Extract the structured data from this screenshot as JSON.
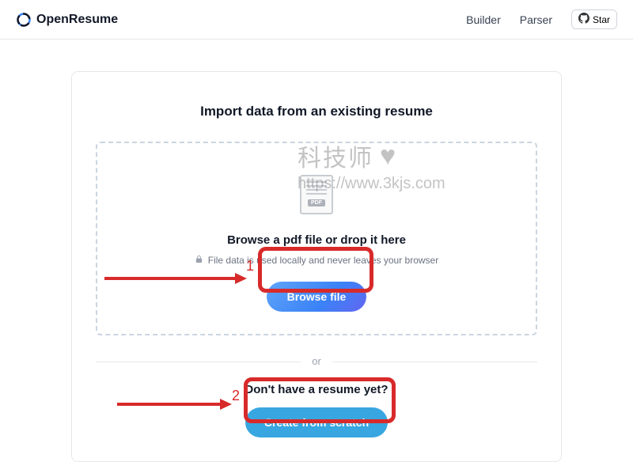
{
  "header": {
    "brand": "OpenResume",
    "nav": {
      "builder": "Builder",
      "parser": "Parser",
      "star": "Star"
    }
  },
  "import": {
    "title": "Import data from an existing resume",
    "file_badge": "PDF",
    "browse_title": "Browse a pdf file or drop it here",
    "privacy": "File data is used locally and never leaves your browser",
    "browse_btn": "Browse file"
  },
  "divider": "or",
  "scratch": {
    "title": "Don't have a resume yet?",
    "create_btn": "Create from scratch"
  },
  "annotations": {
    "num1": "1",
    "num2": "2"
  },
  "watermark": {
    "cn": "科技师",
    "url": "https://www.3kjs.com"
  }
}
